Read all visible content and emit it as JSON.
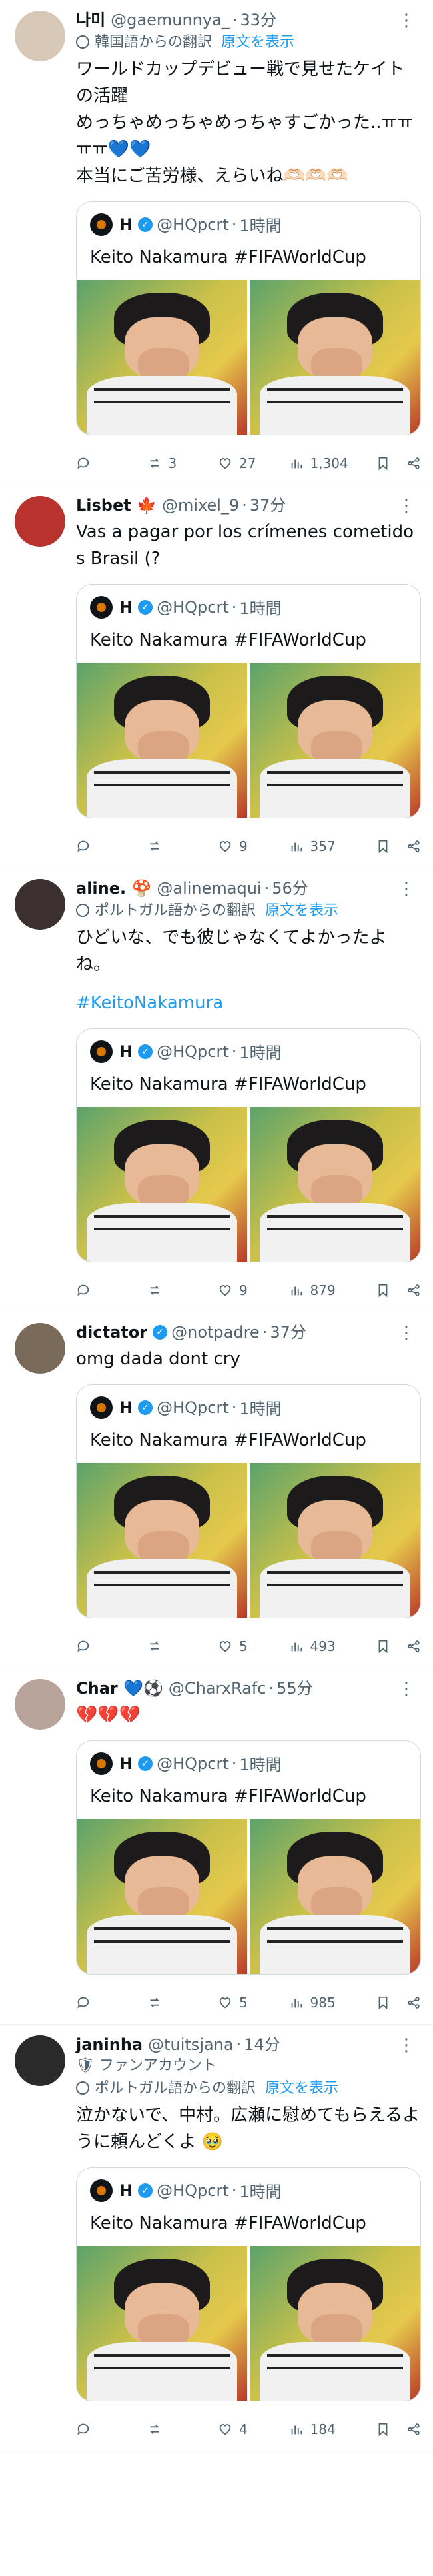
{
  "feed": {
    "items": [
      {
        "name": "나미",
        "handle": "@gaemunnya_",
        "time": "33分",
        "body": "ワールドカップデビュー戦で見せたケイトの活躍\nめっちゃめっちゃめっちゃすごかった..ㅠㅠㅠㅠ💙💙\n本当にご苦労様、えらいね🫶🏻🫶🏻🫶🏻",
        "translate": {
          "label": "韓国語からの翻訳",
          "link": "原文を表示"
        },
        "quote": {
          "name": "H",
          "handle": "@HQpcrt",
          "time": "1時間",
          "text": "Keito Nakamura #FIFAWorldCup"
        },
        "stats": {
          "reply": "",
          "repost": "3",
          "like": "27",
          "views": "1,304"
        },
        "avatar_color": "#d8c8b8"
      },
      {
        "name": "Lisbet 🍁",
        "handle": "@mixel_9",
        "time": "37分",
        "body": "Vas a pagar por los crímenes cometidos Brasil (?",
        "quote": {
          "name": "H",
          "handle": "@HQpcrt",
          "time": "1時間",
          "text": "Keito Nakamura #FIFAWorldCup"
        },
        "stats": {
          "reply": "",
          "repost": "",
          "like": "9",
          "views": "357"
        },
        "avatar_color": "#b8322e"
      },
      {
        "name": "aline. 🍄",
        "handle": "@alinemaqui",
        "time": "56分",
        "translate": {
          "label": "ポルトガル語からの翻訳",
          "link": "原文を表示"
        },
        "body": "ひどいな、でも彼じゃなくてよかったよね。",
        "hashtag": "#KeitoNakamura",
        "quote": {
          "name": "H",
          "handle": "@HQpcrt",
          "time": "1時間",
          "text": "Keito Nakamura #FIFAWorldCup"
        },
        "stats": {
          "reply": "",
          "repost": "",
          "like": "9",
          "views": "879"
        },
        "avatar_color": "#3b2f2f"
      },
      {
        "name": "dictator",
        "verified": true,
        "handle": "@notpadre",
        "time": "37分",
        "body": "omg dada dont cry",
        "quote": {
          "name": "H",
          "handle": "@HQpcrt",
          "time": "1時間",
          "text": "Keito Nakamura #FIFAWorldCup"
        },
        "stats": {
          "reply": "",
          "repost": "",
          "like": "5",
          "views": "493"
        },
        "avatar_color": "#7a6a5a"
      },
      {
        "name": "Char 💙⚽",
        "handle": "@CharxRafc",
        "time": "55分",
        "body": "💔💔💔",
        "quote": {
          "name": "H",
          "handle": "@HQpcrt",
          "time": "1時間",
          "text": "Keito Nakamura #FIFAWorldCup"
        },
        "stats": {
          "reply": "",
          "repost": "",
          "like": "5",
          "views": "985"
        },
        "avatar_color": "#b7a39a"
      },
      {
        "name": "janinha",
        "handle": "@tuitsjana",
        "time": "14分",
        "fan_label": "ファンアカウント",
        "translate": {
          "label": "ポルトガル語からの翻訳",
          "link": "原文を表示"
        },
        "body": "泣かないで、中村。広瀬に慰めてもらえるように頼んどくよ 🥹",
        "quote": {
          "name": "H",
          "handle": "@HQpcrt",
          "time": "1時間",
          "text": "Keito Nakamura #FIFAWorldCup"
        },
        "stats": {
          "reply": "",
          "repost": "",
          "like": "4",
          "views": "184"
        },
        "avatar_color": "#2a2a2a"
      }
    ]
  }
}
